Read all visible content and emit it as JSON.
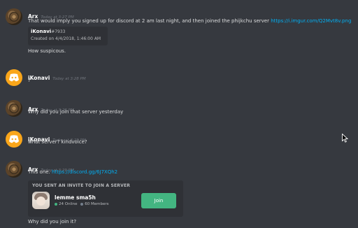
{
  "messages": [
    {
      "author": "Arx",
      "timestamp": "Today at 3:27 PM",
      "text": "That would imply you signed up for discord at 2 am last night, and then joined the phijkchu server",
      "link": "https://i.imgur.com/Q2Mvt8v.png",
      "embed": {
        "name": "iKonavi",
        "discriminator": "#7933",
        "created": "Created on 4/4/2018, 1:46:00 AM"
      },
      "text2": "How suspicous."
    },
    {
      "author": "iKonavi",
      "timestamp": "Today at 3:28 PM",
      "text": "?"
    },
    {
      "author": "Arx",
      "timestamp": "Today at 3:29 PM",
      "text": "Why did you join that server yesterday"
    },
    {
      "author": "iKonavi",
      "timestamp": "Today at 3:29 PM",
      "text": "what server? kindvoice?"
    },
    {
      "author": "Arx",
      "timestamp": "Today at 3:29 PM",
      "text": "This one.",
      "link": "https://discord.gg/6J7XQh2",
      "invite": {
        "header": "YOU SENT AN INVITE TO JOIN A SERVER",
        "server_name": "lemme sma5h",
        "online": "24 Online",
        "members": "60 Members",
        "join_label": "Join"
      },
      "text2": "Why did you join it?"
    }
  ],
  "colors": {
    "background": "#36393f",
    "link": "#00b0f4",
    "join": "#43b581",
    "discord_avatar": "#faa61a"
  },
  "icons": {
    "discord_avatar": "discord-logo-icon",
    "cursor": "mouse-pointer-icon"
  }
}
